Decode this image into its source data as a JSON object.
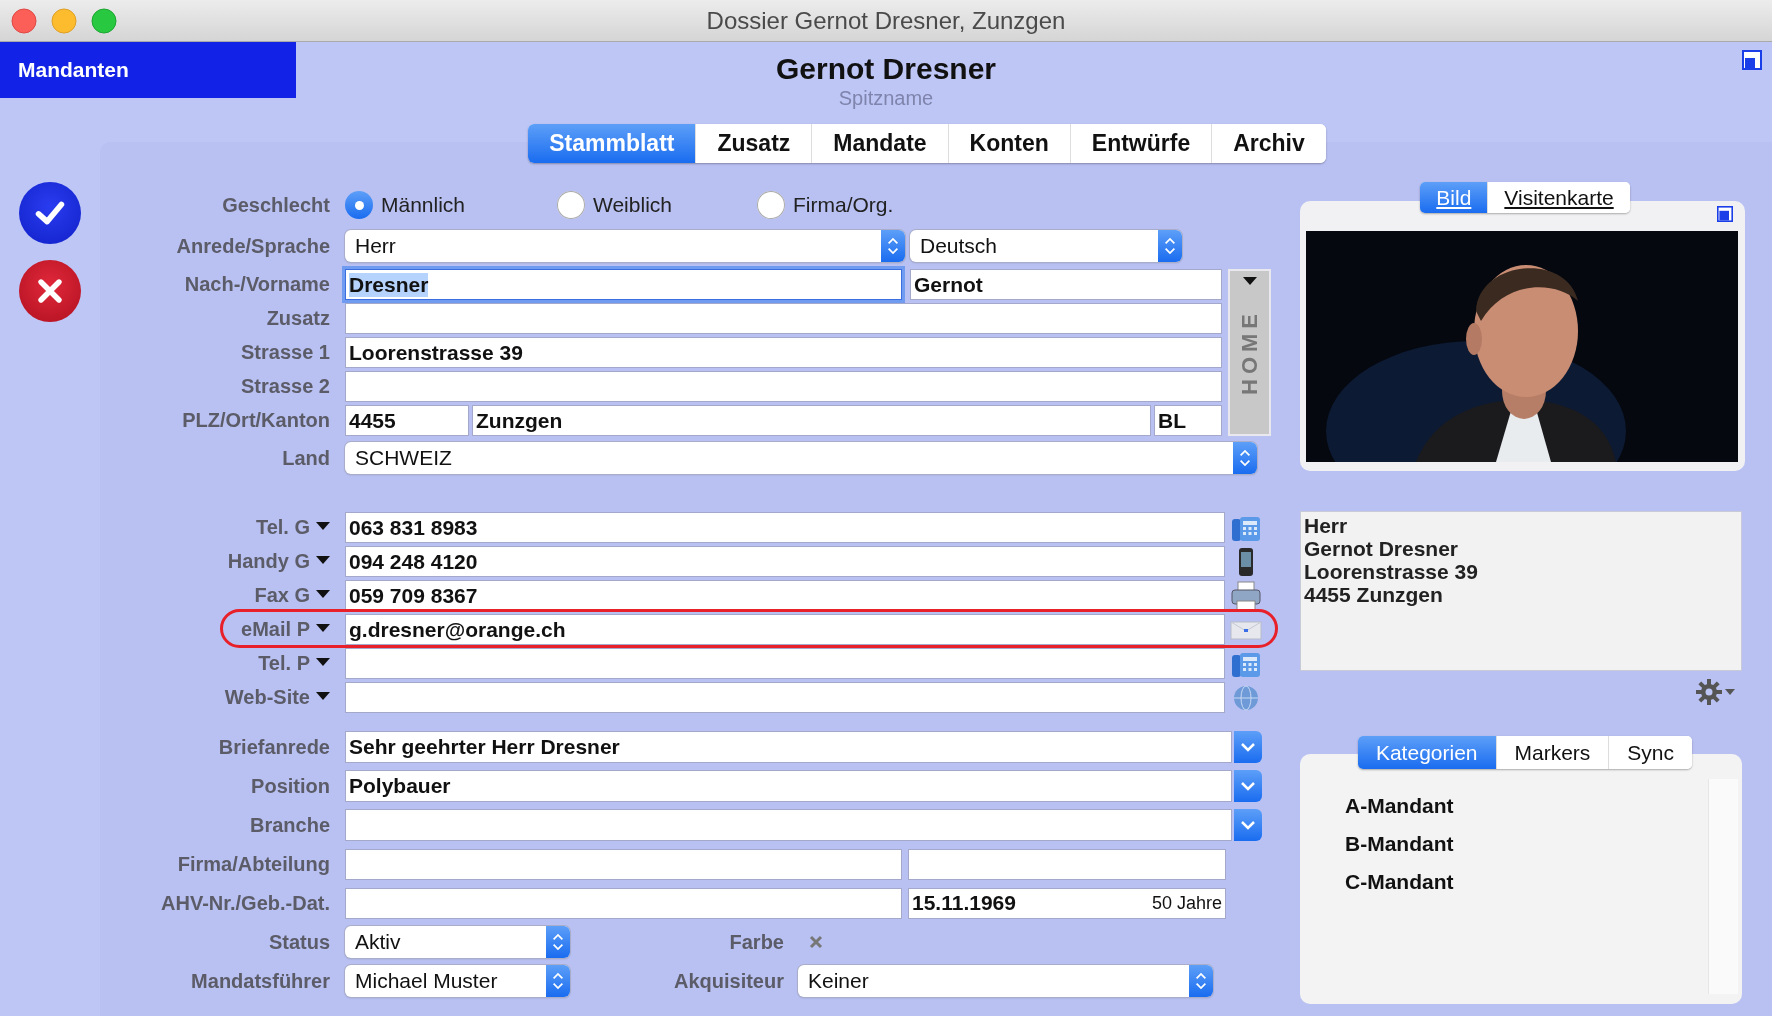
{
  "window": {
    "title": "Dossier Gernot Dresner, Zunzgen"
  },
  "sidebar": {
    "label": "Mandanten"
  },
  "header": {
    "name": "Gernot Dresner",
    "nickname_placeholder": "Spitzname"
  },
  "tabs": [
    {
      "label": "Stammblatt",
      "selected": true
    },
    {
      "label": "Zusatz",
      "selected": false
    },
    {
      "label": "Mandate",
      "selected": false
    },
    {
      "label": "Konten",
      "selected": false
    },
    {
      "label": "Entwürfe",
      "selected": false
    },
    {
      "label": "Archiv",
      "selected": false
    }
  ],
  "gender": {
    "label": "Geschlecht",
    "options": [
      {
        "label": "Männlich",
        "selected": true
      },
      {
        "label": "Weiblich",
        "selected": false
      },
      {
        "label": "Firma/Org.",
        "selected": false
      }
    ]
  },
  "language_row": {
    "label": "Anrede/Sprache",
    "popups": [
      "Herr",
      "Deutsch"
    ]
  },
  "address": {
    "strip_label": "HOME",
    "rows": [
      {
        "label": "Nach-/Vorname",
        "kind": "split",
        "fields": [
          {
            "value": "Dresner",
            "focused": true
          },
          {
            "value": "Gernot",
            "focused": false
          }
        ]
      },
      {
        "label": "Zusatz",
        "kind": "single",
        "fields": [
          {
            "focused": false
          }
        ]
      },
      {
        "label": "Strasse 1",
        "kind": "single",
        "fields": [
          {
            "value": "Loorenstrasse 39",
            "focused": false
          }
        ]
      },
      {
        "label": "Strasse 2",
        "kind": "single",
        "fields": [
          {
            "focused": false
          }
        ]
      },
      {
        "label": "PLZ/Ort/Kanton",
        "kind": "plz",
        "fields": [
          {
            "value": "4455",
            "focused": false
          },
          {
            "value": "Zunzgen",
            "focused": false
          },
          {
            "value": "BL",
            "focused": false
          }
        ]
      }
    ]
  },
  "country": {
    "label": "Land",
    "value": "SCHWEIZ"
  },
  "contacts": [
    {
      "label": "Tel. G",
      "kind": "phone",
      "value": "063 831 8983",
      "highlighted": false
    },
    {
      "label": "Handy G",
      "kind": "mobile",
      "value": "094 248 4120",
      "highlighted": false
    },
    {
      "label": "Fax G",
      "kind": "fax",
      "value": "059 709 8367",
      "highlighted": false
    },
    {
      "label": "eMail P",
      "kind": "email",
      "value": "g.dresner@orange.ch",
      "highlighted": true
    },
    {
      "label": "Tel. P",
      "kind": "phone",
      "highlighted": false
    },
    {
      "label": "Web-Site",
      "kind": "web",
      "highlighted": false
    }
  ],
  "details": [
    {
      "label": "Briefanrede",
      "kind": "combo",
      "value": "Sehr geehrter Herr Dresner"
    },
    {
      "label": "Position",
      "kind": "combo",
      "value": "Polybauer"
    },
    {
      "label": "Branche",
      "kind": "combo"
    },
    {
      "label": "Firma/Abteilung",
      "kind": "split",
      "fields": [
        {
          "kind": "text"
        },
        {
          "kind": "text"
        }
      ]
    },
    {
      "label": "AHV-Nr./Geb.-Dat.",
      "kind": "split",
      "fields": [
        {
          "kind": "text"
        },
        {
          "kind": "date",
          "value": "15.11.1969",
          "note": "50 Jahre"
        }
      ]
    }
  ],
  "status": {
    "label": "Status",
    "value": "Aktiv",
    "color_label": "Farbe"
  },
  "managers": {
    "label": "Mandatsführer",
    "value": "Michael Muster",
    "acquirer_label": "Akquisiteur",
    "acquirer_value": "Keiner"
  },
  "photo": {
    "tabs": [
      {
        "label": "Bild",
        "selected": true
      },
      {
        "label": "Visitenkarte",
        "selected": false
      }
    ],
    "kind": "picture"
  },
  "address_card": {
    "lines": [
      "Herr",
      "Gernot Dresner",
      "Loorenstrasse 39",
      "4455 Zunzgen"
    ]
  },
  "categories": {
    "tabs": [
      {
        "label": "Kategorien",
        "selected": true
      },
      {
        "label": "Markers",
        "selected": false
      },
      {
        "label": "Sync",
        "selected": false
      }
    ],
    "items": [
      "A-Mandant",
      "B-Mandant",
      "C-Mandant"
    ]
  }
}
